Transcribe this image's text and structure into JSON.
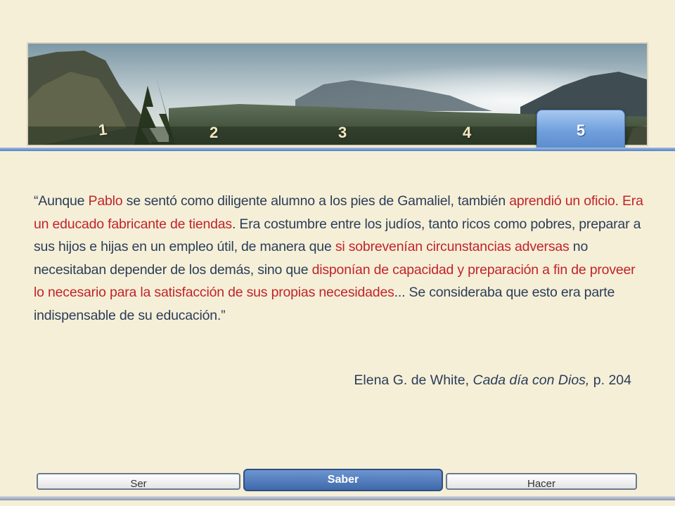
{
  "tabs": [
    "1",
    "2",
    "3",
    "4",
    "5"
  ],
  "active_tab": "5",
  "quote": {
    "p1": "“Aunque ",
    "r1": "Pablo",
    "p2": " se sentó como diligente alumno a los pies de Gamaliel, también ",
    "r2": "aprendió un oficio.  Era un educado fabricante de tiendas",
    "p3": ".  Era costumbre entre los judíos, tanto ricos como pobres, preparar a sus hijos e hijas en un empleo útil, de manera que ",
    "r3": "si sobrevenían circunstancias adversas",
    "p4": " no necesitaban depender de los demás, sino que ",
    "r4": "disponían de capacidad y preparación a fin de proveer lo necesario para la satisfacción de sus propias necesidades",
    "p5": "...  Se consideraba que esto era parte indispensable de su educación.”"
  },
  "citation": {
    "author": "Elena G. de White, ",
    "book": "Cada día con Dios,",
    "page": " p. 204"
  },
  "nav": {
    "ser": "Ser",
    "saber": "Saber",
    "hacer": "Hacer",
    "active": "Saber"
  },
  "colors": {
    "background": "#f6efd8",
    "text": "#2a3e57",
    "highlight": "#c0242a",
    "accent": "#5d8ccd"
  }
}
